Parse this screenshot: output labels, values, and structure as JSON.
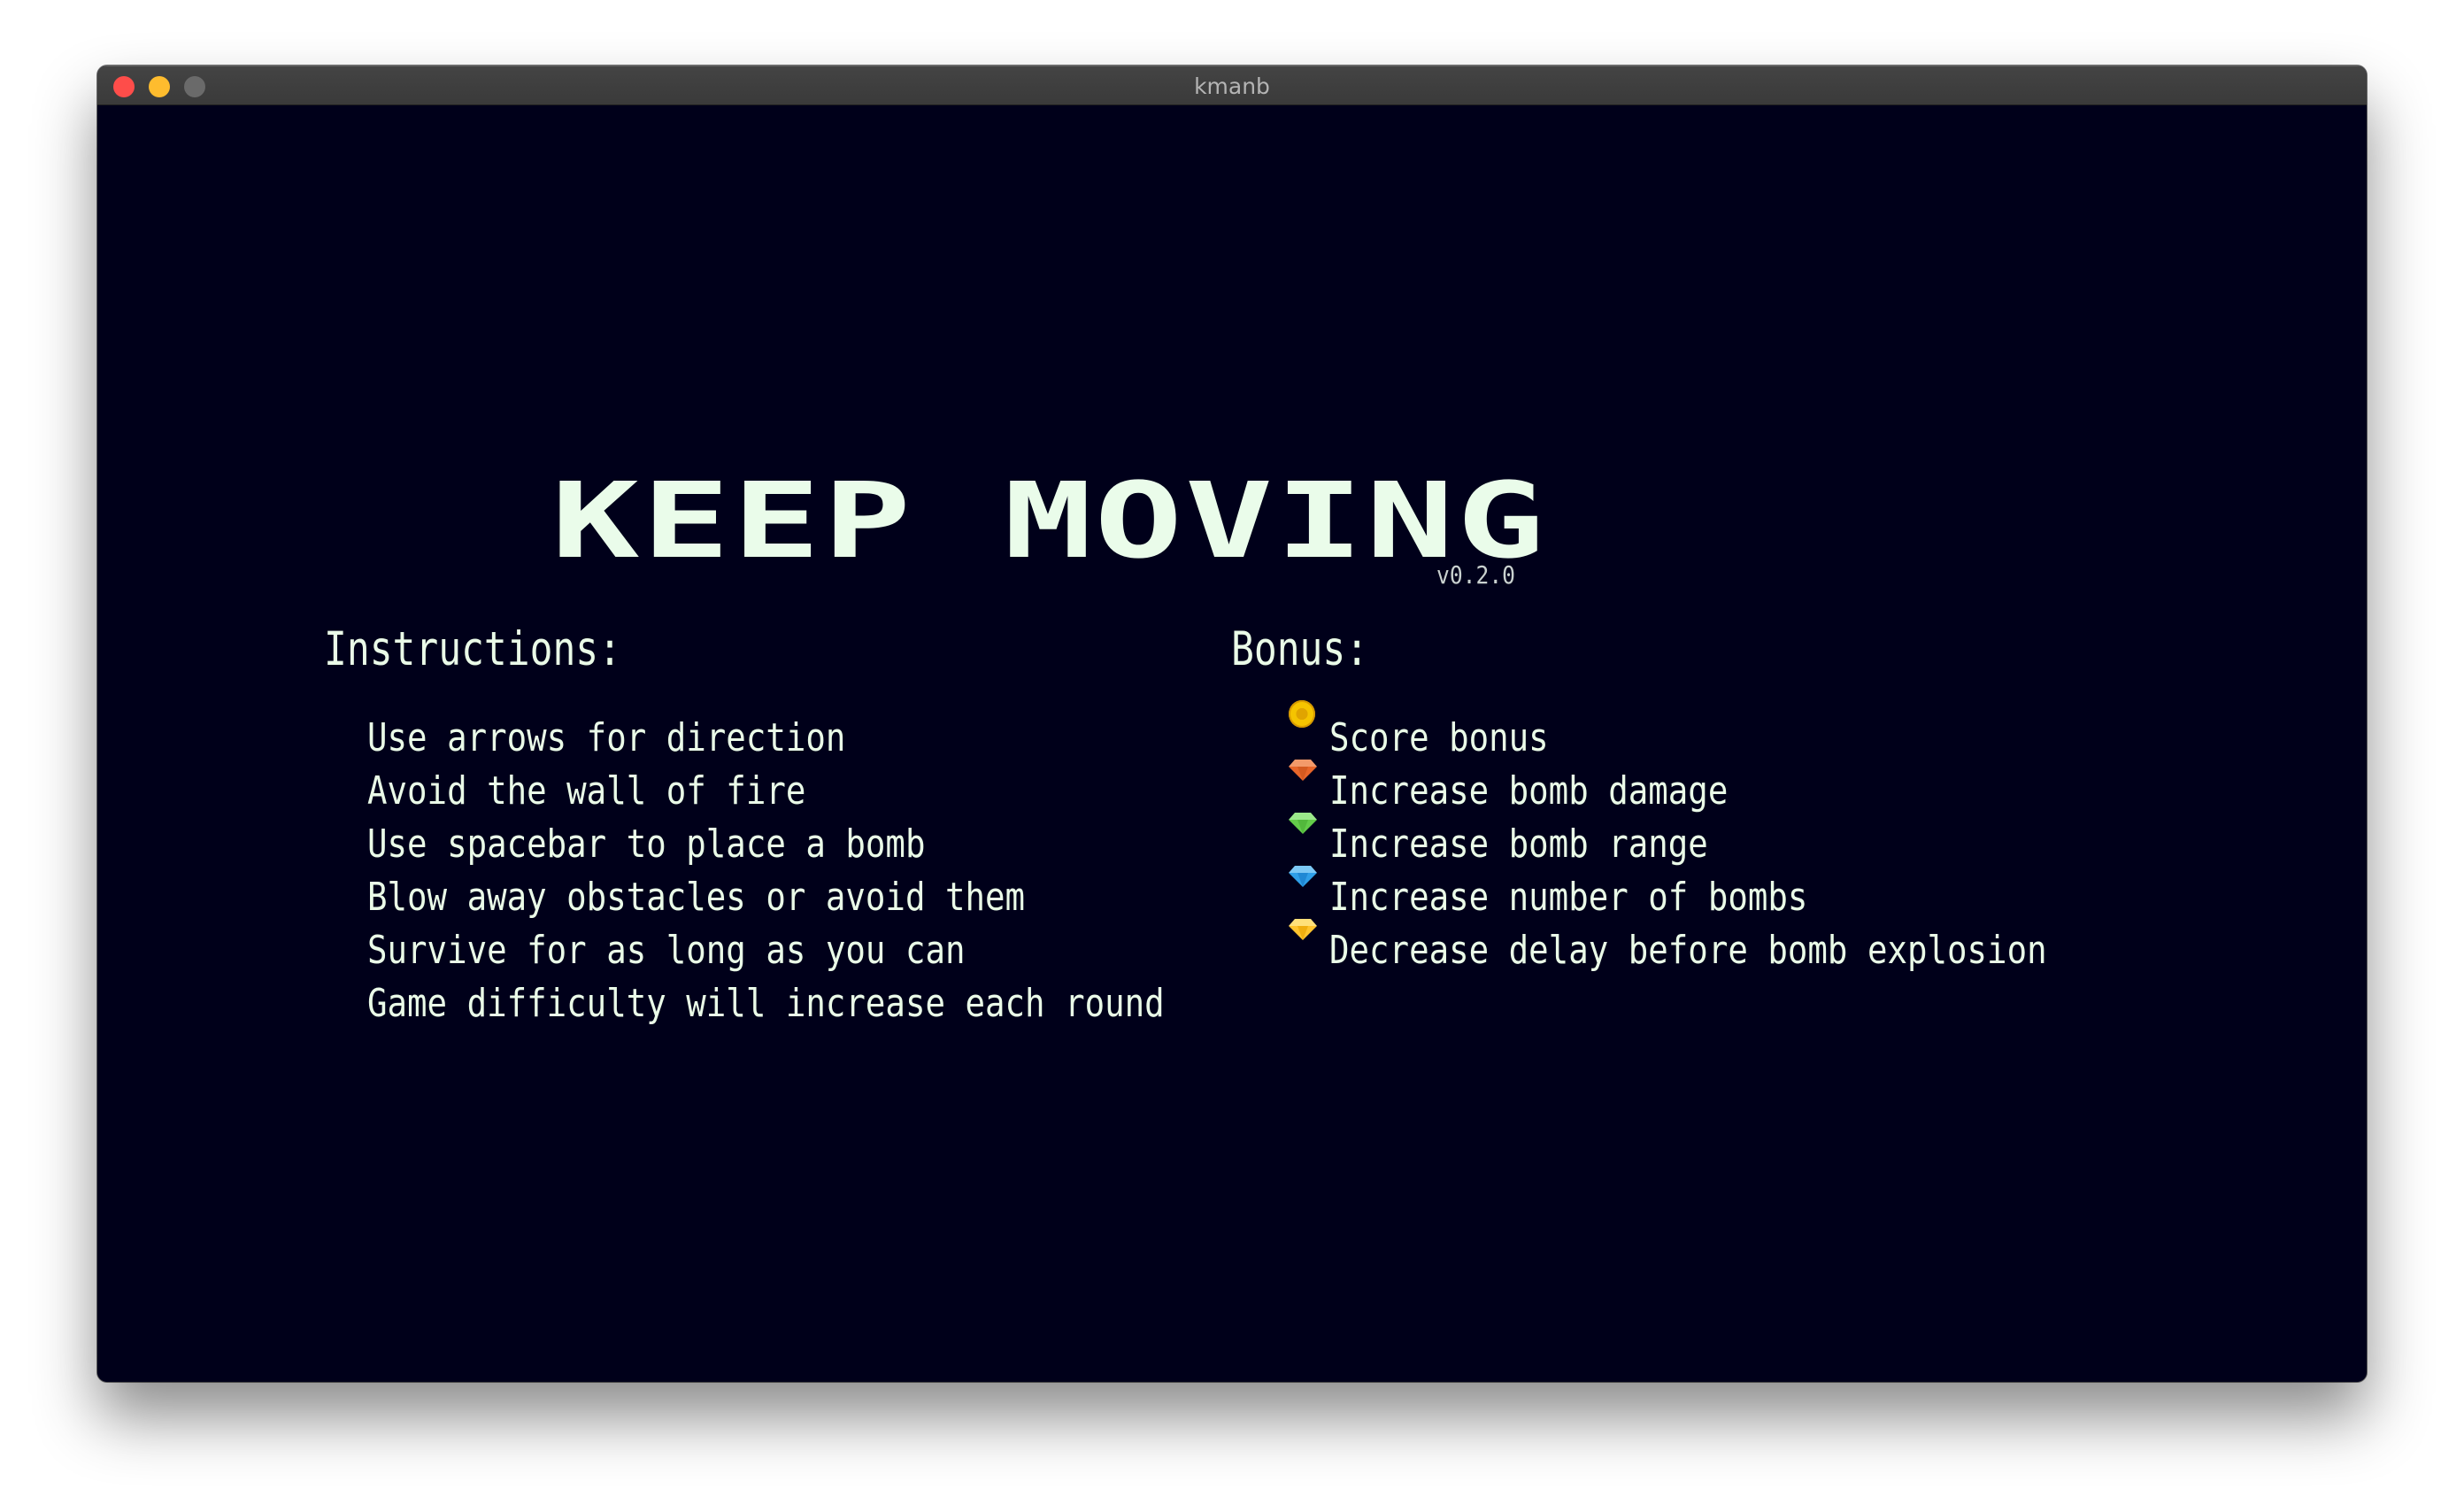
{
  "window": {
    "title": "kmanb",
    "controls": {
      "close_color": "#fe4d4a",
      "minimize_color": "#febc2e",
      "maximize_color": "#6a6a6a"
    }
  },
  "game": {
    "title": "KEEP MOVING",
    "version": "v0.2.0"
  },
  "instructions": {
    "heading": "Instructions:",
    "items": [
      "Use arrows for direction",
      "Avoid the wall of fire",
      "Use spacebar to place a bomb",
      "Blow away obstacles or avoid them",
      "Survive for as long as you can",
      "Game difficulty will increase each round"
    ]
  },
  "bonus": {
    "heading": "Bonus:",
    "items": [
      {
        "icon": "coin-icon",
        "color": "#f5c400",
        "label": "Score bonus"
      },
      {
        "icon": "orange-gem-icon",
        "color": "#f0763a",
        "label": "Increase bomb damage"
      },
      {
        "icon": "green-gem-icon",
        "color": "#6fd858",
        "label": "Increase bomb range"
      },
      {
        "icon": "blue-gem-icon",
        "color": "#3aa8ee",
        "label": "Increase number of bombs"
      },
      {
        "icon": "yellow-gem-icon",
        "color": "#ffc933",
        "label": "Decrease delay before bomb explosion"
      }
    ]
  },
  "colors": {
    "background": "#00001a",
    "text": "#eafbe8",
    "version_text": "#c9d1cf"
  }
}
